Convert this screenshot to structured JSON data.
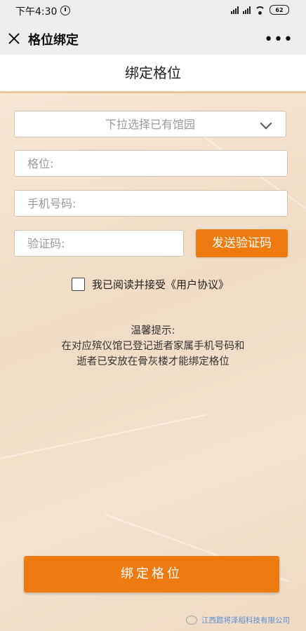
{
  "status_bar": {
    "time": "下午4:30",
    "battery": "62"
  },
  "nav": {
    "title": "格位绑定"
  },
  "page": {
    "title": "绑定格位"
  },
  "form": {
    "cemetery_select_placeholder": "下拉选择已有馆园",
    "niche_placeholder": "格位:",
    "phone_placeholder": "手机号码:",
    "code_placeholder": "验证码:",
    "send_code_label": "发送验证码",
    "agree_label": "我已阅读并接受《用户协议》"
  },
  "tips": {
    "title": "温馨提示:",
    "line1": "在对应殡仪馆已登记逝者家属手机号码和",
    "line2": "逝者已安放在骨灰楼才能绑定格位"
  },
  "bind_button_label": "绑定格位",
  "watermark_text": "江西题将泽稻科技有限公司",
  "colors": {
    "accent": "#ee7b12",
    "background": "#f3e3d1"
  }
}
